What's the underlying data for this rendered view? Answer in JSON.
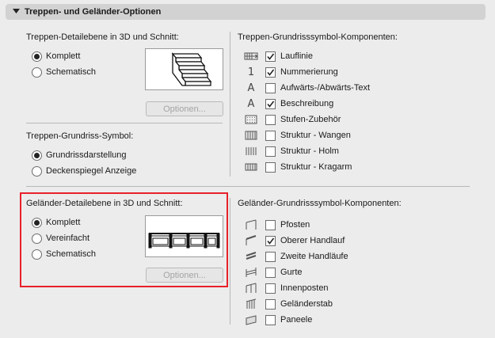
{
  "panel": {
    "title": "Treppen- und Geländer-Optionen"
  },
  "stair_detail": {
    "title": "Treppen-Detailebene in 3D und Schnitt:",
    "options": [
      {
        "label": "Komplett",
        "selected": true
      },
      {
        "label": "Schematisch",
        "selected": false
      }
    ],
    "options_button": "Optionen..."
  },
  "stair_symbol": {
    "title": "Treppen-Grundriss-Symbol:",
    "options": [
      {
        "label": "Grundrissdarstellung",
        "selected": true
      },
      {
        "label": "Deckenspiegel Anzeige",
        "selected": false
      }
    ]
  },
  "stair_components": {
    "title": "Treppen-Grundrisssymbol-Komponenten:",
    "items": [
      {
        "label": "Lauflinie",
        "checked": true,
        "icon": "walking-line-icon"
      },
      {
        "label": "Nummerierung",
        "checked": true,
        "icon": "numbering-icon"
      },
      {
        "label": "Aufwärts-/Abwärts-Text",
        "checked": false,
        "icon": "text-icon"
      },
      {
        "label": "Beschreibung",
        "checked": true,
        "icon": "text-icon"
      },
      {
        "label": "Stufen-Zubehör",
        "checked": false,
        "icon": "tread-accessory-icon"
      },
      {
        "label": "Struktur - Wangen",
        "checked": false,
        "icon": "stringer-icon"
      },
      {
        "label": "Struktur - Holm",
        "checked": false,
        "icon": "beam-icon"
      },
      {
        "label": "Struktur - Kragarm",
        "checked": false,
        "icon": "cantilever-icon"
      }
    ]
  },
  "railing_detail": {
    "title": "Geländer-Detailebene in 3D und Schnitt:",
    "options": [
      {
        "label": "Komplett",
        "selected": true
      },
      {
        "label": "Vereinfacht",
        "selected": false
      },
      {
        "label": "Schematisch",
        "selected": false
      }
    ],
    "options_button": "Optionen..."
  },
  "railing_components": {
    "title": "Geländer-Grundrisssymbol-Komponenten:",
    "items": [
      {
        "label": "Pfosten",
        "checked": false,
        "icon": "post-icon"
      },
      {
        "label": "Oberer Handlauf",
        "checked": true,
        "icon": "top-rail-icon"
      },
      {
        "label": "Zweite Handläufe",
        "checked": false,
        "icon": "handrail-icon"
      },
      {
        "label": "Gurte",
        "checked": false,
        "icon": "rail-icon"
      },
      {
        "label": "Innenposten",
        "checked": false,
        "icon": "inner-post-icon"
      },
      {
        "label": "Geländerstab",
        "checked": false,
        "icon": "baluster-icon"
      },
      {
        "label": "Paneele",
        "checked": false,
        "icon": "panel-icon"
      }
    ]
  },
  "colors": {
    "highlight": "#e8202a",
    "header_bg": "#d2d2d2",
    "background": "#ececec"
  }
}
